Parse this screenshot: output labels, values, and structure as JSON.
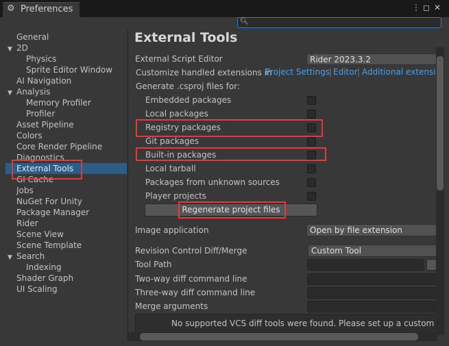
{
  "window": {
    "title": "Preferences",
    "menu_icon": "⋮",
    "maximize_icon": "◻",
    "close_icon": "✕"
  },
  "search": {
    "placeholder": "",
    "value": ""
  },
  "sidebar": {
    "items": [
      {
        "label": "General"
      },
      {
        "label": "2D"
      },
      {
        "label": "Physics"
      },
      {
        "label": "Sprite Editor Window"
      },
      {
        "label": "AI Navigation"
      },
      {
        "label": "Analysis"
      },
      {
        "label": "Memory Profiler"
      },
      {
        "label": "Profiler"
      },
      {
        "label": "Asset Pipeline"
      },
      {
        "label": "Colors"
      },
      {
        "label": "Core Render Pipeline"
      },
      {
        "label": "Diagnostics"
      },
      {
        "label": "External Tools"
      },
      {
        "label": "GI Cache"
      },
      {
        "label": "Jobs"
      },
      {
        "label": "NuGet For Unity"
      },
      {
        "label": "Package Manager"
      },
      {
        "label": "Rider"
      },
      {
        "label": "Scene View"
      },
      {
        "label": "Scene Template"
      },
      {
        "label": "Search"
      },
      {
        "label": "Indexing"
      },
      {
        "label": "Shader Graph"
      },
      {
        "label": "UI Scaling"
      }
    ],
    "selected": "External Tools"
  },
  "content": {
    "title": "External Tools",
    "script_editor_label": "External Script Editor",
    "script_editor_value": "Rider 2023.3.2",
    "customize_label": "Customize handled extensions in",
    "link_project_settings": "Project Settings",
    "link_editor": "Editor",
    "link_additional": "Additional extensio",
    "link_sep": "|",
    "generate_label": "Generate .csproj files for:",
    "csproj_options": [
      {
        "label": "Embedded packages",
        "checked": false
      },
      {
        "label": "Local packages",
        "checked": false
      },
      {
        "label": "Registry packages",
        "checked": false
      },
      {
        "label": "Git packages",
        "checked": false
      },
      {
        "label": "Built-in packages",
        "checked": false
      },
      {
        "label": "Local tarball",
        "checked": false
      },
      {
        "label": "Packages from unknown sources",
        "checked": false
      },
      {
        "label": "Player projects",
        "checked": false
      }
    ],
    "regenerate_button": "Regenerate project files",
    "image_app_label": "Image application",
    "image_app_value": "Open by file extension",
    "revision_label": "Revision Control Diff/Merge",
    "revision_value": "Custom Tool",
    "tool_path_label": "Tool Path",
    "two_way_label": "Two-way diff command line",
    "three_way_label": "Three-way diff command line",
    "merge_label": "Merge arguments",
    "help_text": "No supported VCS diff tools were found. Please set up a custom tool or install one of the following tools:"
  },
  "colors": {
    "highlight": "#e23b3b",
    "selection": "#2c5d87",
    "link": "#4c9fe8"
  }
}
